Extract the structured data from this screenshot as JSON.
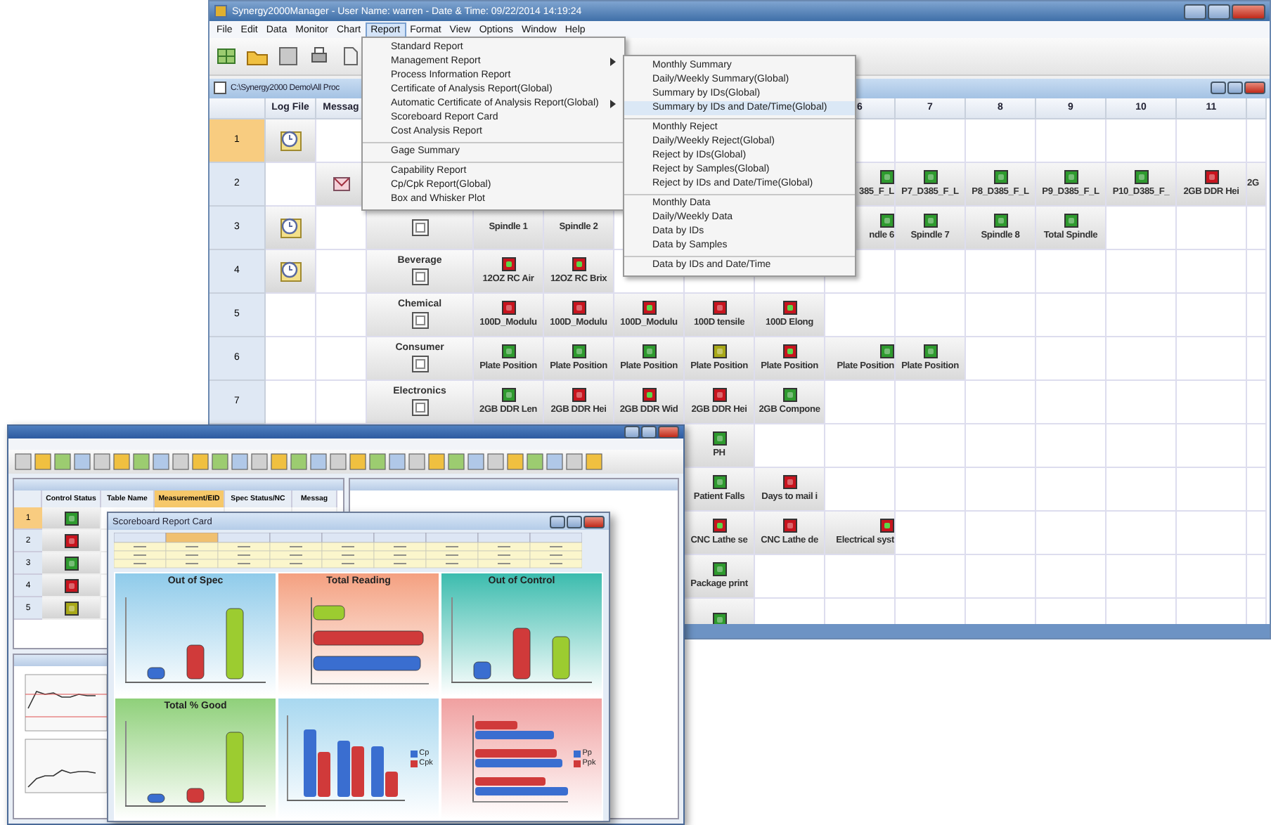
{
  "main_window": {
    "title": "Synergy2000Manager - User Name: warren - Date & Time: 09/22/2014 14:19:24",
    "menu": [
      {
        "label": "File",
        "selected": false
      },
      {
        "label": "Edit",
        "selected": false
      },
      {
        "label": "Data",
        "selected": false
      },
      {
        "label": "Monitor",
        "selected": false
      },
      {
        "label": "Chart",
        "selected": false
      },
      {
        "label": "Report",
        "selected": true
      },
      {
        "label": "Format",
        "selected": false
      },
      {
        "label": "View",
        "selected": false
      },
      {
        "label": "Options",
        "selected": false
      },
      {
        "label": "Window",
        "selected": false
      },
      {
        "label": "Help",
        "selected": false
      }
    ],
    "child_window": {
      "title": "C:\\Synergy2000 Demo\\All Proc"
    },
    "fixed_columns": [
      "Log File",
      "Messag"
    ],
    "columns": [
      {},
      {},
      {},
      {},
      {},
      {
        "label": "6"
      },
      {
        "label": "7"
      },
      {
        "label": "8"
      },
      {
        "label": "9"
      },
      {
        "label": "10"
      },
      {
        "label": "11"
      },
      {}
    ],
    "rows": [
      {
        "number": "1",
        "selected": true,
        "log_file": true,
        "message": false,
        "cells": []
      },
      {
        "number": "2",
        "selected": false,
        "log_file": false,
        "message": true,
        "cells": [
          null,
          null,
          null,
          null,
          null,
          {
            "color": "#2e9a2e",
            "inner_ok": false,
            "label": "385_F_L"
          },
          {
            "color": "#2e9a2e",
            "inner_ok": false,
            "label": "P7_D385_F_L"
          },
          {
            "color": "#2e9a2e",
            "inner_ok": false,
            "label": "P8_D385_F_L"
          },
          {
            "color": "#2e9a2e",
            "inner_ok": false,
            "label": "P9_D385_F_L"
          },
          {
            "color": "#2e9a2e",
            "inner_ok": false,
            "label": "P10_D385_F_"
          },
          {
            "color": "#c8141e",
            "inner_ok": false,
            "label": "2GB DDR Hei"
          },
          {
            "label": "2G"
          }
        ]
      },
      {
        "number": "3",
        "selected": false,
        "log_file": true,
        "message": false,
        "group": {},
        "cells": [
          {
            "label": "Spindle 1"
          },
          {
            "label": "Spindle 2"
          },
          null,
          null,
          null,
          {
            "color": "#2e9a2e",
            "inner_ok": false,
            "label": "ndle 6"
          },
          {
            "color": "#2e9a2e",
            "inner_ok": false,
            "label": "Spindle 7"
          },
          {
            "color": "#2e9a2e",
            "inner_ok": false,
            "label": "Spindle 8"
          },
          {
            "color": "#2e9a2e",
            "inner_ok": false,
            "label": "Total Spindle"
          }
        ]
      },
      {
        "number": "4",
        "selected": false,
        "log_file": true,
        "message": false,
        "group": {
          "label": "Beverage"
        },
        "cells": [
          {
            "color": "#c8141e",
            "inner_ok": true,
            "label": "12OZ RC Air"
          },
          {
            "color": "#c8141e",
            "inner_ok": true,
            "label": "12OZ RC Brix"
          }
        ]
      },
      {
        "number": "5",
        "selected": false,
        "log_file": false,
        "message": false,
        "group": {
          "label": "Chemical"
        },
        "cells": [
          {
            "color": "#c8141e",
            "inner_ok": false,
            "label": "100D_Modulu"
          },
          {
            "color": "#c8141e",
            "inner_ok": false,
            "label": "100D_Modulu"
          },
          {
            "color": "#c8141e",
            "inner_ok": true,
            "label": "100D_Modulu"
          },
          {
            "color": "#c8141e",
            "inner_ok": false,
            "label": "100D tensile"
          },
          {
            "color": "#c8141e",
            "inner_ok": true,
            "label": "100D Elong"
          }
        ]
      },
      {
        "number": "6",
        "selected": false,
        "log_file": false,
        "message": false,
        "group": {
          "label": "Consumer"
        },
        "cells": [
          {
            "color": "#2e9a2e",
            "inner_ok": false,
            "label": "Plate Position"
          },
          {
            "color": "#2e9a2e",
            "inner_ok": false,
            "label": "Plate Position"
          },
          {
            "color": "#2e9a2e",
            "inner_ok": false,
            "label": "Plate Position"
          },
          {
            "color": "#a8a818",
            "inner_ok": false,
            "label": "Plate Position"
          },
          {
            "color": "#c8141e",
            "inner_ok": true,
            "label": "Plate Position"
          },
          {
            "color": "#2e9a2e",
            "inner_ok": false,
            "label": "Plate Position"
          },
          {
            "color": "#2e9a2e",
            "inner_ok": false,
            "label": "Plate Position"
          }
        ]
      },
      {
        "number": "7",
        "selected": false,
        "log_file": false,
        "message": false,
        "group": {
          "label": "Electronics"
        },
        "cells": [
          {
            "color": "#2e9a2e",
            "inner_ok": false,
            "label": "2GB DDR Len"
          },
          {
            "color": "#c8141e",
            "inner_ok": false,
            "label": "2GB DDR Hei"
          },
          {
            "color": "#c8141e",
            "inner_ok": true,
            "label": "2GB DDR Wid"
          },
          {
            "color": "#c8141e",
            "inner_ok": false,
            "label": "2GB DDR Hei"
          },
          {
            "color": "#2e9a2e",
            "inner_ok": false,
            "label": "2GB Compone"
          }
        ]
      },
      {
        "cells": [
          null,
          null,
          null,
          {
            "color": "#2e9a2e",
            "inner_ok": false,
            "label": "PH"
          }
        ]
      },
      {
        "cells": [
          null,
          null,
          null,
          {
            "color": "#2e9a2e",
            "inner_ok": false,
            "label": "Patient Falls"
          },
          {
            "color": "#c8141e",
            "inner_ok": false,
            "label": "Days to mail i"
          }
        ]
      },
      {
        "cells": [
          null,
          null,
          null,
          {
            "color": "#c8141e",
            "inner_ok": true,
            "label": "CNC Lathe se"
          },
          {
            "color": "#c8141e",
            "inner_ok": false,
            "label": "CNC Lathe de"
          },
          {
            "color": "#c8141e",
            "inner_ok": true,
            "label": "Electrical syst"
          }
        ]
      },
      {
        "cells": [
          null,
          null,
          null,
          {
            "color": "#2e9a2e",
            "inner_ok": false,
            "label": "Package print"
          }
        ]
      },
      {
        "cells": [
          null,
          null,
          null,
          {
            "color": "#2e9a2e",
            "inner_ok": false
          }
        ]
      }
    ]
  },
  "report_menu": [
    {
      "label": "Standard Report",
      "has_submenu": false,
      "separator_before": false
    },
    {
      "label": "Management Report",
      "has_submenu": true,
      "separator_before": false
    },
    {
      "label": "Process Information Report",
      "has_submenu": false,
      "separator_before": false
    },
    {
      "label": "Certificate of Analysis Report(Global)",
      "has_submenu": false,
      "separator_before": false
    },
    {
      "label": "Automatic Certificate of Analysis Report(Global)",
      "has_submenu": true,
      "separator_before": false
    },
    {
      "label": "Scoreboard Report Card",
      "has_submenu": false,
      "separator_before": false
    },
    {
      "label": "Cost Analysis Report",
      "has_submenu": false,
      "separator_before": false
    },
    {
      "label": "Gage Summary",
      "has_submenu": false,
      "separator_before": true
    },
    {
      "label": "Capability Report",
      "has_submenu": false,
      "separator_before": true
    },
    {
      "label": "Cp/Cpk Report(Global)",
      "has_submenu": false,
      "separator_before": false
    },
    {
      "label": "Box and Whisker Plot",
      "has_submenu": false,
      "separator_before": false
    }
  ],
  "management_submenu": [
    {
      "label": "Monthly Summary",
      "selected": false,
      "separator_before": false
    },
    {
      "label": "Daily/Weekly Summary(Global)",
      "selected": false,
      "separator_before": false
    },
    {
      "label": "Summary by IDs(Global)",
      "selected": false,
      "separator_before": false
    },
    {
      "label": "Summary by IDs and Date/Time(Global)",
      "selected": true,
      "separator_before": false
    },
    {
      "label": "Monthly Reject",
      "selected": false,
      "separator_before": true
    },
    {
      "label": "Daily/Weekly Reject(Global)",
      "selected": false,
      "separator_before": false
    },
    {
      "label": "Reject by IDs(Global)",
      "selected": false,
      "separator_before": false
    },
    {
      "label": "Reject by Samples(Global)",
      "selected": false,
      "separator_before": false
    },
    {
      "label": "Reject by IDs and Date/Time(Global)",
      "selected": false,
      "separator_before": false
    },
    {
      "label": "Monthly Data",
      "selected": false,
      "separator_before": true
    },
    {
      "label": "Daily/Weekly Data",
      "selected": false,
      "separator_before": false
    },
    {
      "label": "Data by IDs",
      "selected": false,
      "separator_before": false
    },
    {
      "label": "Data by Samples",
      "selected": false,
      "separator_before": false
    },
    {
      "label": "Data by IDs and Date/Time",
      "selected": false,
      "separator_before": true
    }
  ],
  "second_window": {
    "table": {
      "columns": [
        {
          "label": "Control Status",
          "selected": false
        },
        {
          "label": "Table Name",
          "selected": false
        },
        {
          "label": "Measurement/EID",
          "selected": true
        },
        {
          "label": "Spec Status/NC",
          "selected": false
        },
        {
          "label": "Messag",
          "selected": false
        }
      ],
      "rows": [
        {
          "number": "1",
          "selected": true,
          "color": "#2e9a2e"
        },
        {
          "number": "2",
          "selected": false,
          "color": "#c8141e"
        },
        {
          "number": "3",
          "selected": false,
          "color": "#2e9a2e"
        },
        {
          "number": "4",
          "selected": false,
          "color": "#c8141e"
        },
        {
          "number": "5",
          "selected": false,
          "color": "#a8a818"
        }
      ]
    },
    "report_window": {
      "title": "Scoreboard Report Card",
      "panels": [
        {
          "title": "Out of Spec",
          "kind": "vertical",
          "color": "#8fcbea"
        },
        {
          "title": "Total Reading",
          "kind": "horizontal",
          "color": "#f4a080"
        },
        {
          "title": "Out of Control",
          "kind": "vertical",
          "color": "#3cbcae"
        },
        {
          "title": "Total % Good",
          "kind": "vertical",
          "color": "#8fd07a"
        },
        {
          "kind": "grouped",
          "color": "#a8d8f0",
          "legend": [
            "Cp",
            "Cpk"
          ]
        },
        {
          "kind": "grouped_horizontal",
          "color": "#f0a0a0",
          "legend": [
            "Pp",
            "Ppk"
          ]
        }
      ]
    }
  }
}
